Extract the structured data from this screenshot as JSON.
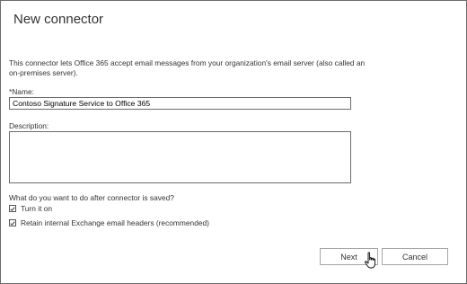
{
  "dialog": {
    "title": "New connector",
    "intro_line1": "This connector lets Office 365 accept email messages from your organization's email server (also called an",
    "intro_line2": "on-premises server)."
  },
  "form": {
    "name_label": "*Name:",
    "name_value": "Contoso Signature Service to Office 365",
    "description_label": "Description:",
    "description_value": "",
    "after_save_question": "What do you want to do after connector is saved?",
    "options": [
      {
        "label": "Turn it on",
        "checked": true
      },
      {
        "label": "Retain internal Exchange email headers (recommended)",
        "checked": true
      }
    ]
  },
  "buttons": {
    "next_label": "Next",
    "cancel_label": "Cancel"
  },
  "icons": {
    "checkmark": "checkmark-icon",
    "cursor": "hand-pointer-icon"
  }
}
